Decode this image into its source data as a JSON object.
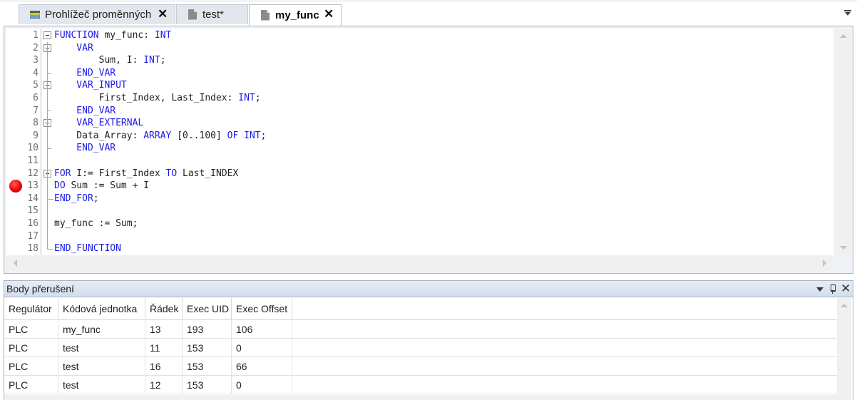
{
  "tabs": [
    {
      "label": "Prohlížeč proměnných",
      "icon": "variable-viewer-icon",
      "closable": true,
      "active": false
    },
    {
      "label": "test*",
      "icon": "document-icon",
      "closable": false,
      "active": false
    },
    {
      "label": "my_func",
      "icon": "document-icon",
      "closable": true,
      "active": true
    }
  ],
  "editor": {
    "lines": [
      {
        "n": "1",
        "code": [
          {
            "t": "FUNCTION",
            "k": true
          },
          {
            "t": " my_func: ",
            "k": false
          },
          {
            "t": "INT",
            "k": true
          }
        ]
      },
      {
        "n": "2",
        "code": [
          {
            "t": "    VAR",
            "k": true
          }
        ]
      },
      {
        "n": "3",
        "code": [
          {
            "t": "        Sum, I: ",
            "k": false
          },
          {
            "t": "INT",
            "k": true
          },
          {
            "t": ";",
            "k": false
          }
        ]
      },
      {
        "n": "4",
        "code": [
          {
            "t": "    END_VAR",
            "k": true
          }
        ]
      },
      {
        "n": "5",
        "code": [
          {
            "t": "    VAR_INPUT",
            "k": true
          }
        ]
      },
      {
        "n": "6",
        "code": [
          {
            "t": "        First_Index, Last_Index: ",
            "k": false
          },
          {
            "t": "INT",
            "k": true
          },
          {
            "t": ";",
            "k": false
          }
        ]
      },
      {
        "n": "7",
        "code": [
          {
            "t": "    END_VAR",
            "k": true
          }
        ]
      },
      {
        "n": "8",
        "code": [
          {
            "t": "    VAR_EXTERNAL",
            "k": true
          }
        ]
      },
      {
        "n": "9",
        "code": [
          {
            "t": "    Data_Array: ",
            "k": false
          },
          {
            "t": "ARRAY",
            "k": true
          },
          {
            "t": " [0..100] ",
            "k": false
          },
          {
            "t": "OF",
            "k": true
          },
          {
            "t": " ",
            "k": false
          },
          {
            "t": "INT",
            "k": true
          },
          {
            "t": ";",
            "k": false
          }
        ]
      },
      {
        "n": "10",
        "code": [
          {
            "t": "    END_VAR",
            "k": true
          }
        ]
      },
      {
        "n": "11",
        "code": []
      },
      {
        "n": "12",
        "code": [
          {
            "t": "FOR",
            "k": true
          },
          {
            "t": " I:= First_Index ",
            "k": false
          },
          {
            "t": "TO",
            "k": true
          },
          {
            "t": " Last_INDEX",
            "k": false
          }
        ]
      },
      {
        "n": "13",
        "code": [
          {
            "t": "DO",
            "k": true
          },
          {
            "t": " Sum := Sum + I",
            "k": false
          }
        ]
      },
      {
        "n": "14",
        "code": [
          {
            "t": "END_FOR",
            "k": true
          },
          {
            "t": ";",
            "k": false
          }
        ]
      },
      {
        "n": "15",
        "code": []
      },
      {
        "n": "16",
        "code": [
          {
            "t": "my_func := Sum;",
            "k": false
          }
        ]
      },
      {
        "n": "17",
        "code": []
      },
      {
        "n": "18",
        "code": [
          {
            "t": "END_FUNCTION",
            "k": true
          }
        ]
      }
    ],
    "breakpoint_line": "13"
  },
  "breakpoints_panel": {
    "title": "Body přerušení",
    "columns": [
      "Regulátor",
      "Kódová jednotka",
      "Řádek",
      "Exec UID",
      "Exec Offset"
    ],
    "rows": [
      [
        "PLC",
        "my_func",
        "13",
        "193",
        "106"
      ],
      [
        "PLC",
        "test",
        "11",
        "153",
        "0"
      ],
      [
        "PLC",
        "test",
        "16",
        "153",
        "66"
      ],
      [
        "PLC",
        "test",
        "12",
        "153",
        "0"
      ]
    ]
  },
  "colors": {
    "keyword": "#1a1ae6",
    "breakpoint": "#e60000",
    "panel_header": "#d3ddec"
  }
}
